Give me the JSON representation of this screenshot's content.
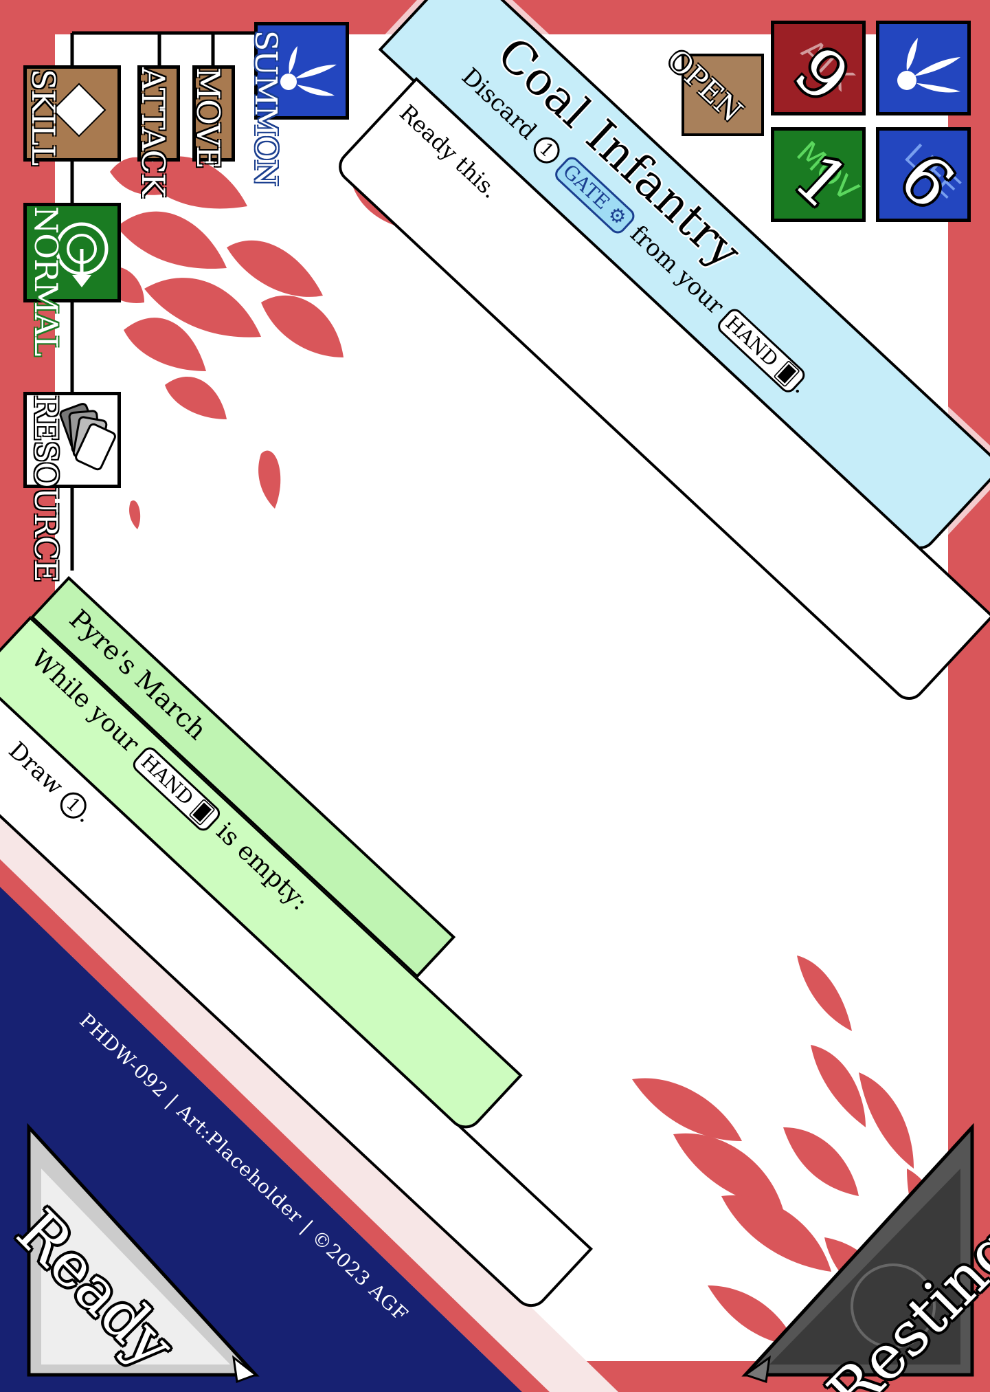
{
  "card": {
    "name": "Coal Infantry",
    "cost_prefix": "Discard",
    "cost_amount": "1",
    "cost_token": "GATE",
    "cost_middle": "from your",
    "cost_zone": "HAND",
    "cost_suffix": ".",
    "effect": "Ready this.",
    "open_label": "OPEN"
  },
  "stats": {
    "atk_label": "ATK",
    "atk": "9",
    "mov_label": "MOV",
    "mov": "1",
    "life_label": "LIFE",
    "life": "6"
  },
  "actions": {
    "summon": "SUMMON",
    "move": "MOVE",
    "attack": "ATTACK",
    "skill": "SKILL",
    "normal": "NORMAL",
    "resource": "RESOURCE"
  },
  "ability": {
    "name": "Pyre's March",
    "condition_prefix": "While your",
    "condition_zone": "HAND",
    "condition_suffix": "is empty:",
    "effect_prefix": "Draw",
    "effect_amount": "1",
    "effect_suffix": "."
  },
  "footer": "PHDW-092 | Art:Placeholder | ©2023 AGF",
  "corners": {
    "ready": "Ready",
    "resting": "Resting"
  },
  "colors": {
    "frame": "#d9565a",
    "title_banner": "#c6edf9",
    "ability_banner": "#bff4b2",
    "corner_navy": "#172172",
    "atk_red": "#9b1f25",
    "mov_green": "#1a7b22",
    "life_blue": "#2346bf",
    "skill_brown": "#a87a50",
    "normal_green": "#1a7b22"
  }
}
